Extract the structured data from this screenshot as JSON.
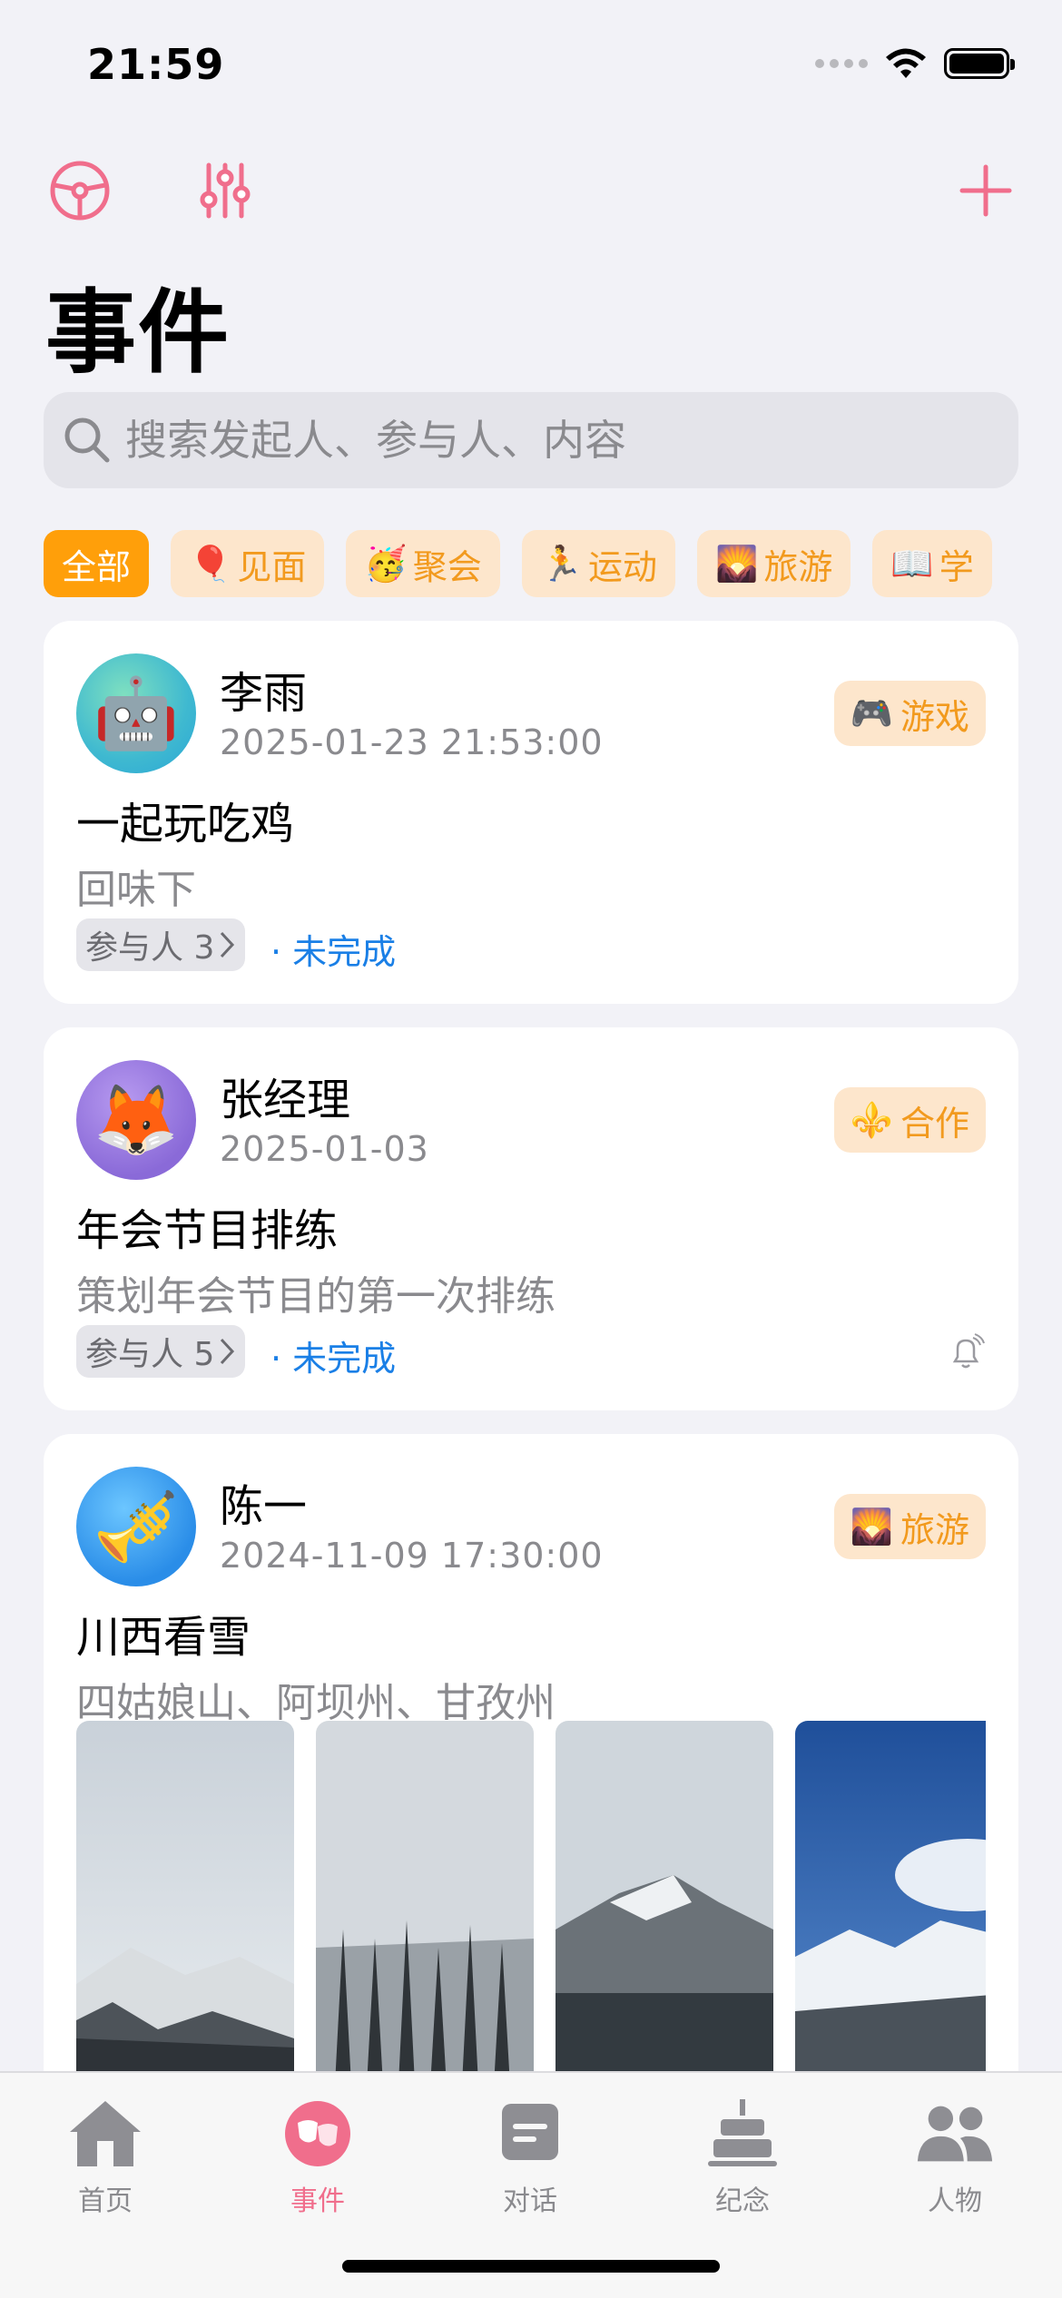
{
  "status_bar": {
    "time": "21:59"
  },
  "header": {
    "title": "事件"
  },
  "search": {
    "placeholder": "搜索发起人、参与人、内容"
  },
  "filters": [
    {
      "label": "全部",
      "emoji": "",
      "active": true
    },
    {
      "label": "见面",
      "emoji": "🎈",
      "active": false
    },
    {
      "label": "聚会",
      "emoji": "🥳",
      "active": false
    },
    {
      "label": "运动",
      "emoji": "🏃",
      "active": false
    },
    {
      "label": "旅游",
      "emoji": "🌄",
      "active": false
    },
    {
      "label": "学",
      "emoji": "📖",
      "active": false
    }
  ],
  "events": [
    {
      "name": "李雨",
      "avatar_emoji": "🤖",
      "date": "2025-01-23 21:53:00",
      "tag_emoji": "🎮",
      "tag_label": "游戏",
      "title": "一起玩吃鸡",
      "subtitle": "回味下",
      "participants": "参与人 3",
      "status": "· 未完成"
    },
    {
      "name": "张经理",
      "avatar_emoji": "🦊",
      "date": "2025-01-03",
      "tag_emoji": "⚜️",
      "tag_label": "合作",
      "title": "年会节目排练",
      "subtitle": "策划年会节目的第一次排练",
      "participants": "参与人 5",
      "status": "· 未完成"
    },
    {
      "name": "陈一",
      "avatar_emoji": "🎺",
      "date": "2024-11-09 17:30:00",
      "tag_emoji": "🌄",
      "tag_label": "旅游",
      "title": "川西看雪",
      "subtitle": "四姑娘山、阿坝州、甘孜州"
    }
  ],
  "tabs": [
    {
      "label": "首页",
      "icon": "house-icon"
    },
    {
      "label": "事件",
      "icon": "theater-masks-icon"
    },
    {
      "label": "对话",
      "icon": "chat-note-icon"
    },
    {
      "label": "纪念",
      "icon": "cake-icon"
    },
    {
      "label": "人物",
      "icon": "people-icon"
    }
  ],
  "colors": {
    "accent_pink": "#f06e8c",
    "accent_orange": "#ff9f0a",
    "tag_bg": "#fde6cc",
    "status_blue": "#1a7fe6"
  }
}
